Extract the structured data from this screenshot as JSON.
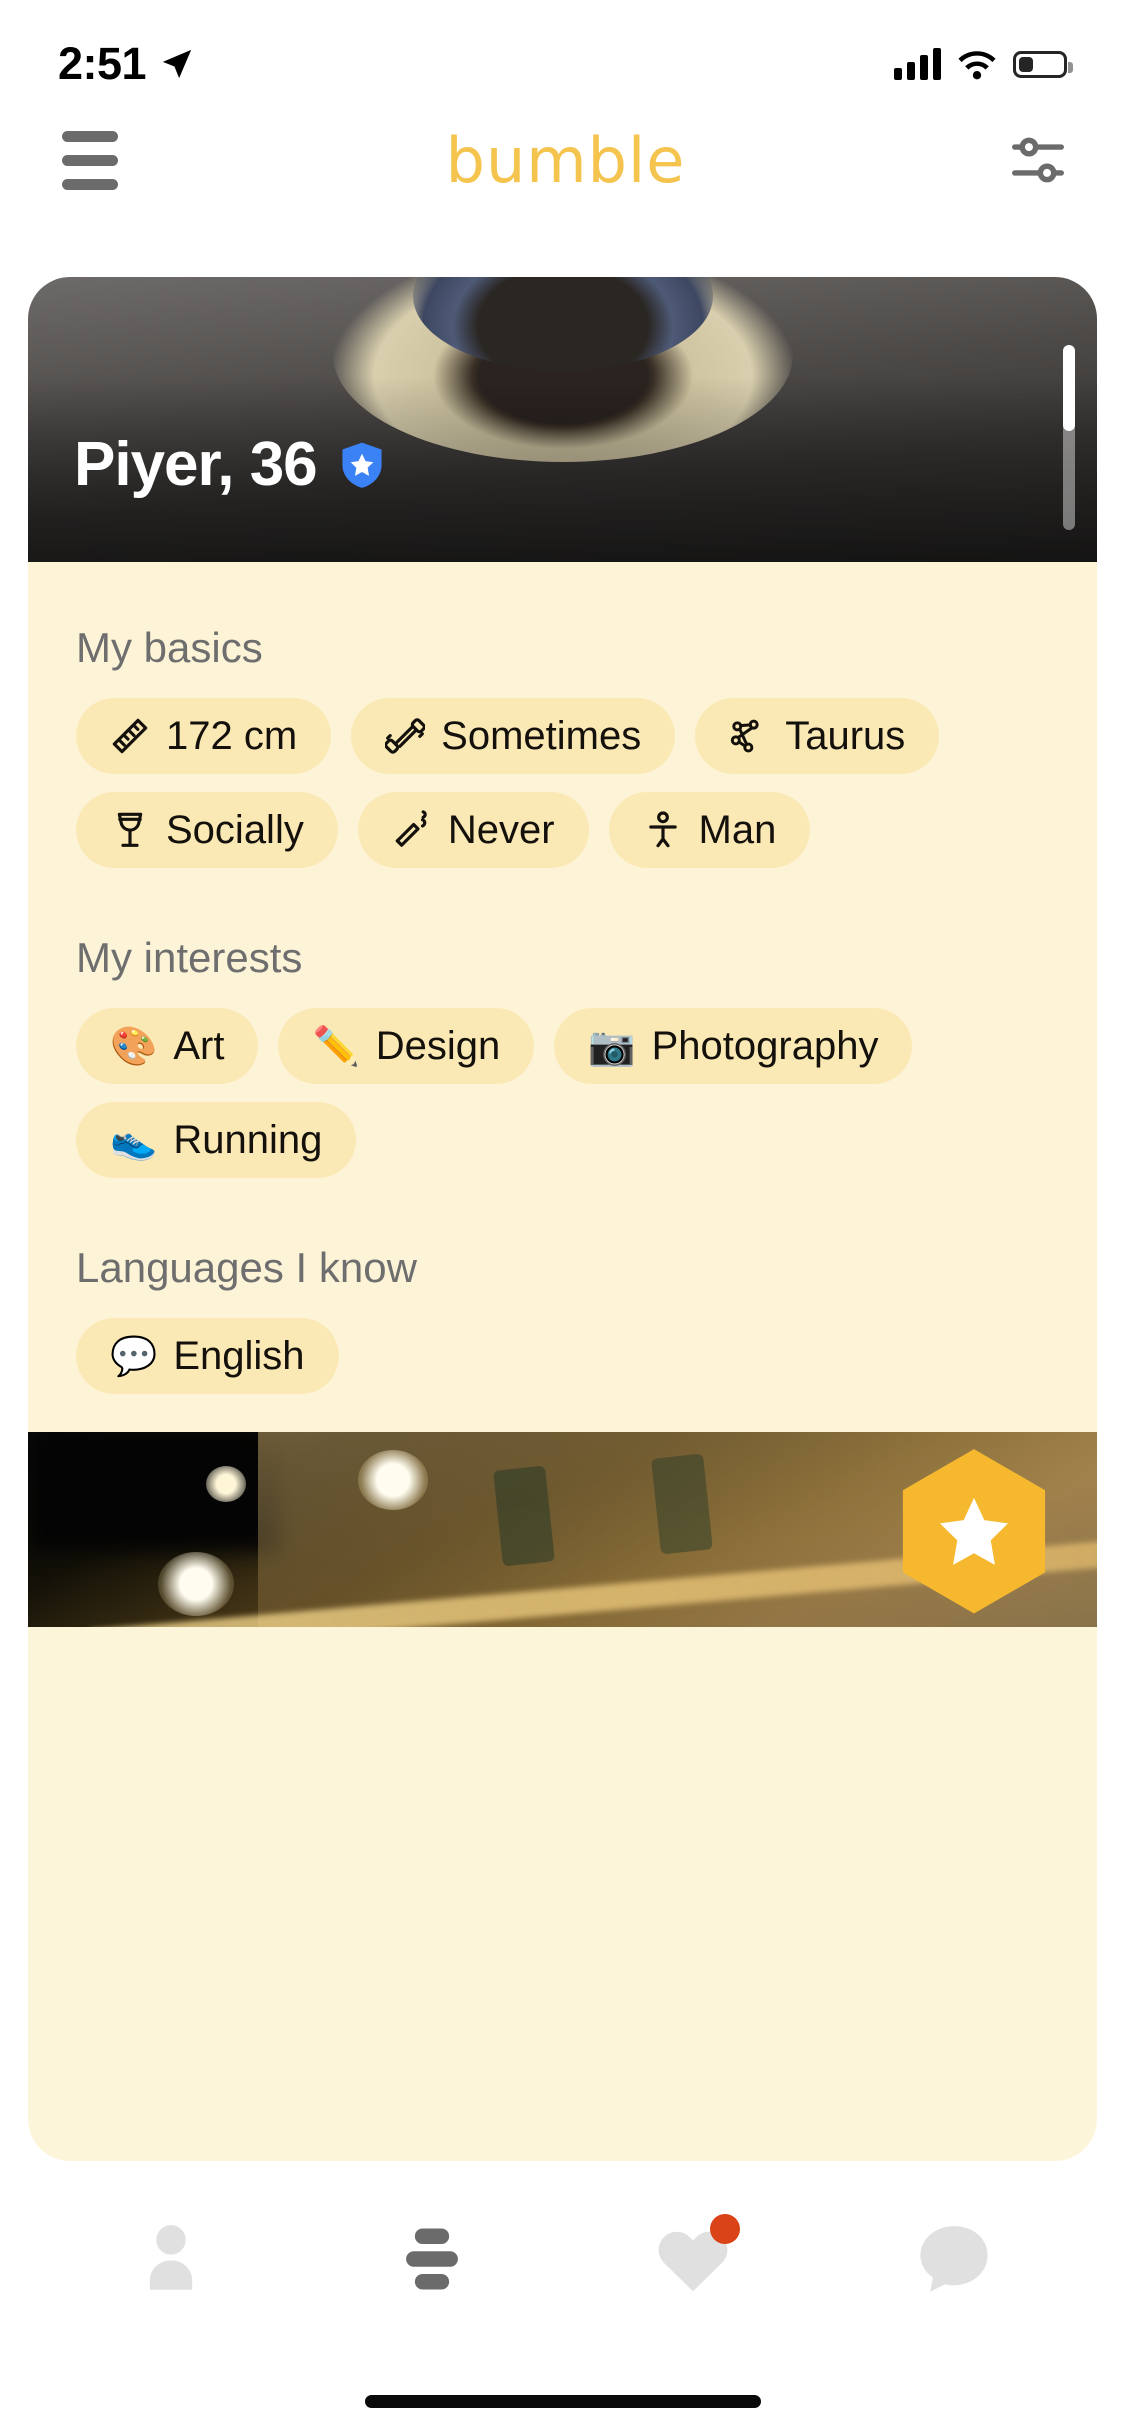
{
  "status_bar": {
    "time": "2:51",
    "location_icon": "location-arrow-icon",
    "signal_icon": "cellular-signal-icon",
    "wifi_icon": "wifi-icon",
    "battery_icon": "battery-low-icon",
    "battery_level_percent": 30
  },
  "header": {
    "menu_icon": "hamburger-menu-icon",
    "brand": "bumble",
    "brand_color": "#f5c44e",
    "filter_icon": "filter-sliders-icon"
  },
  "profile": {
    "name_age": "Piyer, 36",
    "verified_badge_icon": "verified-shield-star-icon",
    "verified_badge_color": "#3b82f6",
    "photo_scroll": {
      "total": 2,
      "current": 1
    }
  },
  "sections": [
    {
      "title": "My basics",
      "chips": [
        {
          "icon": "ruler-icon",
          "icon_type": "svg",
          "label": "172 cm"
        },
        {
          "icon": "dumbbell-icon",
          "icon_type": "svg",
          "label": "Sometimes"
        },
        {
          "icon": "zodiac-taurus-icon",
          "icon_type": "svg",
          "label": "Taurus"
        },
        {
          "icon": "wine-glass-icon",
          "icon_type": "svg",
          "label": "Socially"
        },
        {
          "icon": "cigarette-icon",
          "icon_type": "svg",
          "label": "Never"
        },
        {
          "icon": "gender-man-icon",
          "icon_type": "svg",
          "label": "Man"
        }
      ]
    },
    {
      "title": "My interests",
      "chips": [
        {
          "icon": "🎨",
          "icon_type": "emoji",
          "label": "Art"
        },
        {
          "icon": "✏️",
          "icon_type": "emoji",
          "label": "Design"
        },
        {
          "icon": "📷",
          "icon_type": "emoji",
          "label": "Photography"
        },
        {
          "icon": "👟",
          "icon_type": "emoji",
          "label": "Running"
        }
      ]
    },
    {
      "title": "Languages I know",
      "chips": [
        {
          "icon": "💬",
          "icon_type": "emoji",
          "label": "English"
        }
      ]
    }
  ],
  "superswipe": {
    "icon": "star-icon",
    "hex_color": "#f5b82e"
  },
  "tabbar": {
    "items": [
      {
        "name": "profile",
        "icon": "person-icon",
        "active": false,
        "badge": false
      },
      {
        "name": "discover",
        "icon": "stacked-bars-icon",
        "active": true,
        "badge": false
      },
      {
        "name": "beeline",
        "icon": "heart-icon",
        "active": false,
        "badge": true
      },
      {
        "name": "chat",
        "icon": "chat-bubble-icon",
        "active": false,
        "badge": false
      }
    ],
    "badge_color": "#d94317",
    "active_color": "#6b6b6b",
    "inactive_color": "#e0e0e0"
  },
  "home_indicator": "home-indicator-bar"
}
